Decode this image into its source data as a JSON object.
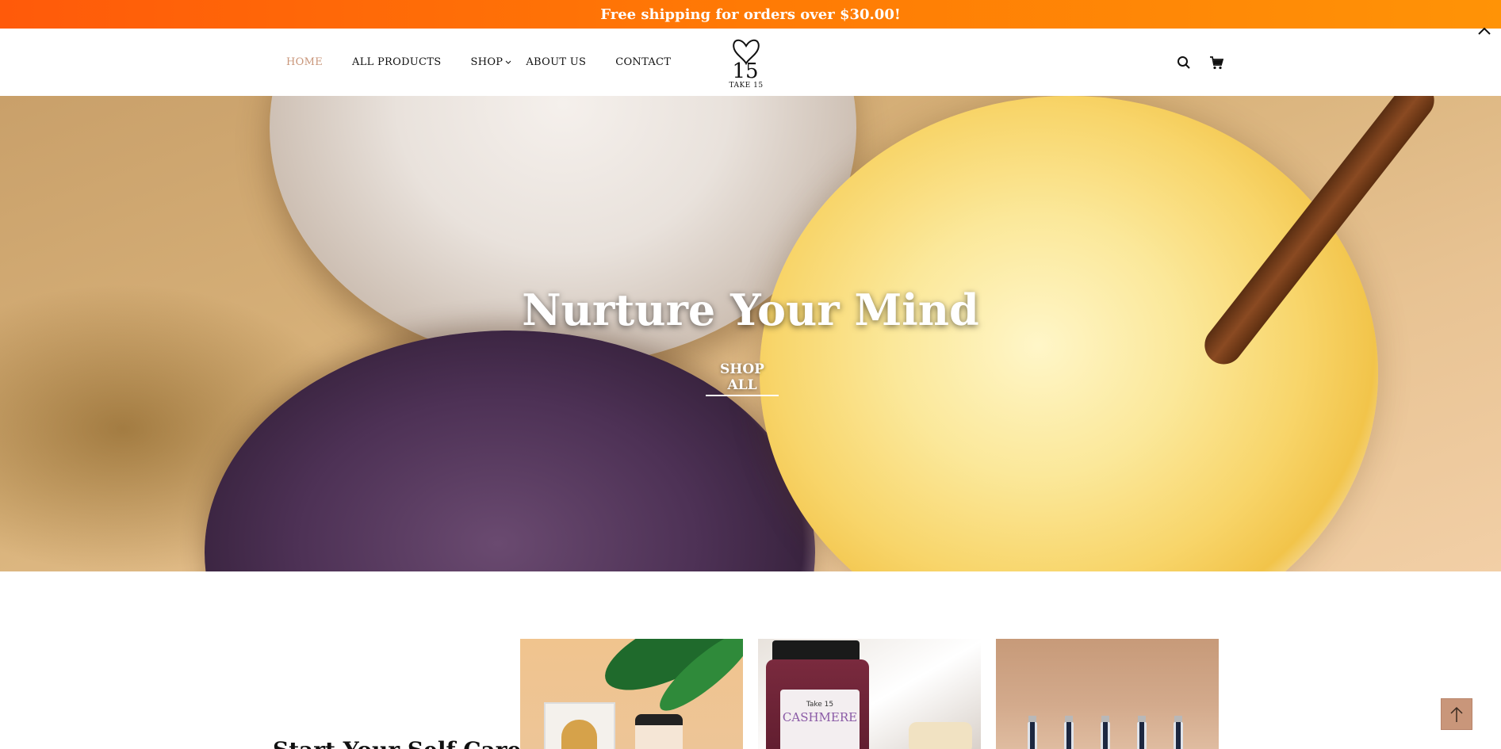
{
  "announcement": {
    "text": "Free shipping for orders over $30.00!"
  },
  "nav": {
    "items": [
      {
        "label": "HOME",
        "active": true
      },
      {
        "label": "ALL PRODUCTS",
        "active": false
      },
      {
        "label": "SHOP",
        "active": false,
        "has_dropdown": true
      },
      {
        "label": "ABOUT US",
        "active": false
      },
      {
        "label": "CONTACT",
        "active": false
      }
    ]
  },
  "logo": {
    "mark": "15",
    "text": "TAKE 15"
  },
  "header_icons": [
    "search-icon",
    "cart-icon"
  ],
  "hero": {
    "title": "Nurture Your Mind",
    "cta": "SHOP ALL"
  },
  "section": {
    "title": "Start Your Self Care"
  },
  "cards": [
    {
      "label_text": ""
    },
    {
      "label_brand": "Take 15",
      "label_name": "CASHMERE"
    },
    {
      "label_text": ""
    }
  ],
  "colors": {
    "announcement_start": "#ff5a0a",
    "announcement_end": "#ff9306",
    "accent": "#c9967a",
    "text": "#111111"
  },
  "back_to_top_icon": "arrow-up-icon",
  "collapse_icon": "chevron-up-icon"
}
